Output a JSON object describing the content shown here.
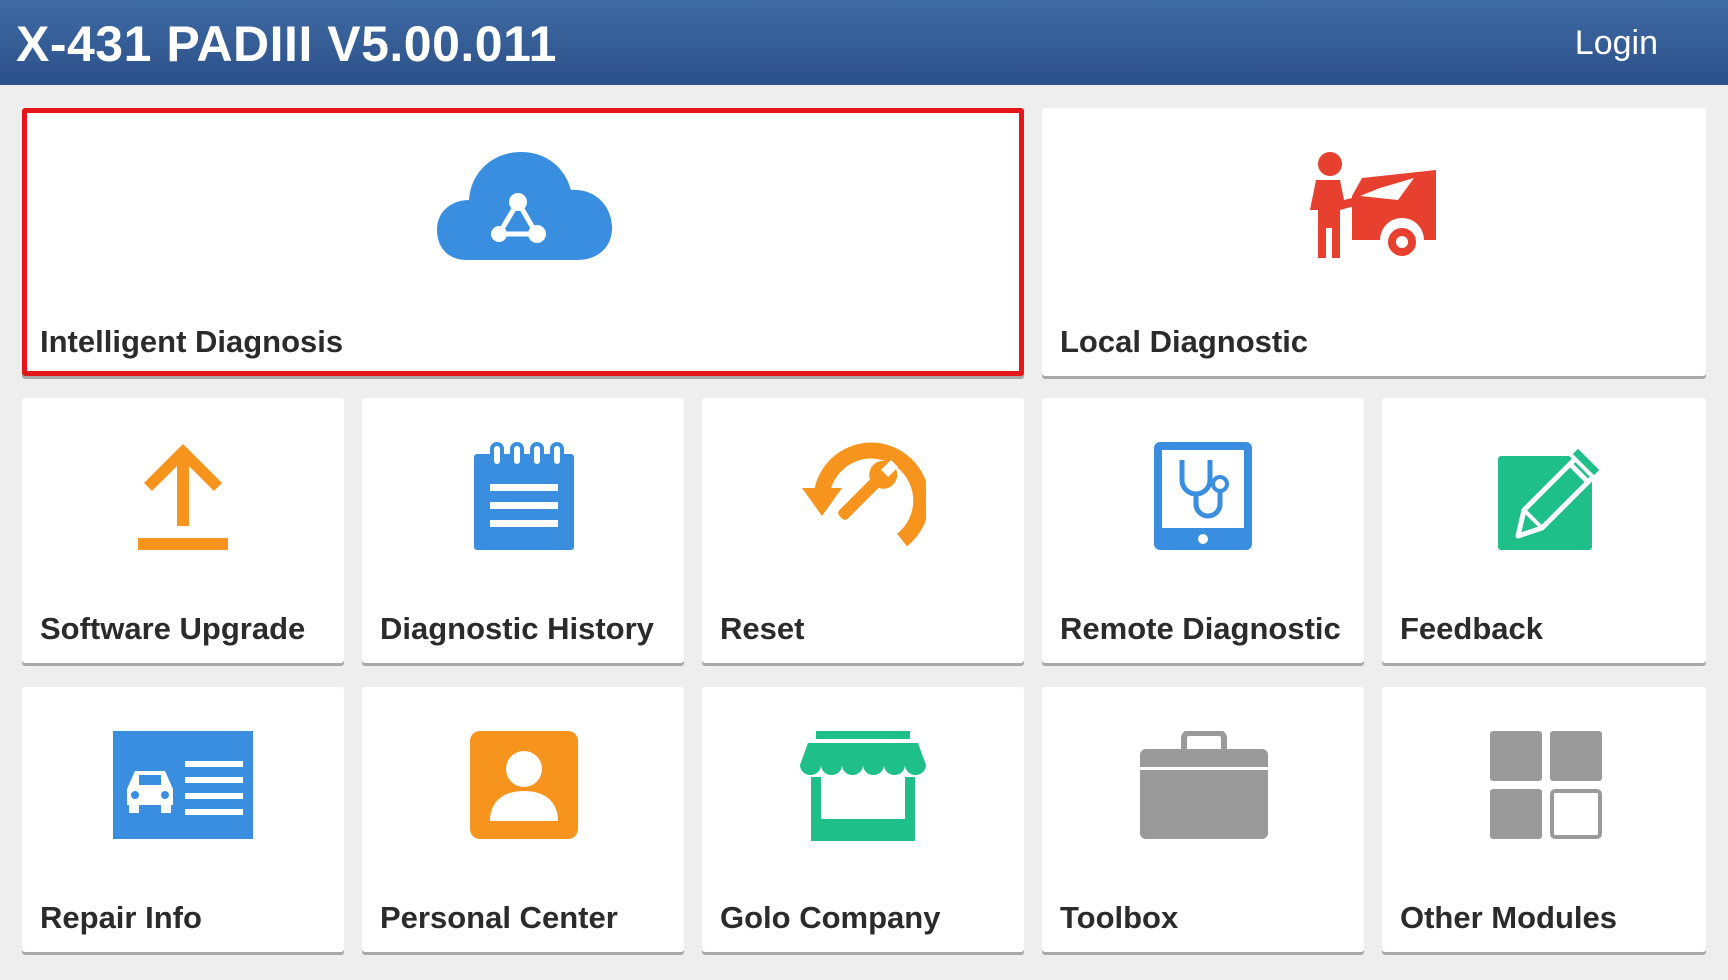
{
  "header": {
    "title": "X-431 PADIII V5.00.011",
    "login_label": "Login"
  },
  "tiles": [
    {
      "label": "Intelligent Diagnosis",
      "icon": "cloud-diagnosis-icon",
      "color": "#3a8ee0",
      "selected": true
    },
    {
      "label": "Local Diagnostic",
      "icon": "mechanic-car-icon",
      "color": "#e8402f"
    },
    {
      "label": "Software Upgrade",
      "icon": "upload-arrow-icon",
      "color": "#f7941d"
    },
    {
      "label": "Diagnostic History",
      "icon": "notepad-icon",
      "color": "#3a8ee0"
    },
    {
      "label": "Reset",
      "icon": "reset-wrench-icon",
      "color": "#f7941d"
    },
    {
      "label": "Remote Diagnostic",
      "icon": "tablet-stethoscope-icon",
      "color": "#3a8ee0"
    },
    {
      "label": "Feedback",
      "icon": "edit-pencil-icon",
      "color": "#1fbf8a"
    },
    {
      "label": "Repair Info",
      "icon": "car-info-card-icon",
      "color": "#3a8ee0"
    },
    {
      "label": "Personal Center",
      "icon": "person-icon",
      "color": "#f7941d"
    },
    {
      "label": "Golo Company",
      "icon": "storefront-icon",
      "color": "#1fbf8a"
    },
    {
      "label": "Toolbox",
      "icon": "toolbox-icon",
      "color": "#9a9a9a"
    },
    {
      "label": "Other Modules",
      "icon": "modules-grid-icon",
      "color": "#9a9a9a"
    }
  ]
}
